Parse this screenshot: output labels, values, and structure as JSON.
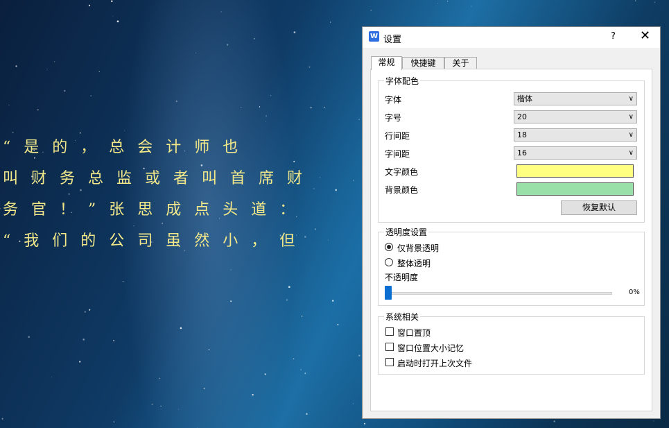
{
  "background_text": {
    "lines": [
      "    “是的，总会计师也",
      "叫财务总监或者叫首席财",
      "务官！”张思成点头道：",
      "“我们的公司虽然小，但"
    ],
    "color": "#f3e98a"
  },
  "dialog": {
    "title": "设置",
    "help_label": "?",
    "close_label": "✕",
    "app_icon": "wps-w-icon",
    "tabs": [
      {
        "label": "常规",
        "active": true
      },
      {
        "label": "快捷键",
        "active": false
      },
      {
        "label": "关于",
        "active": false
      }
    ],
    "font_group": {
      "title": "字体配色",
      "rows": [
        {
          "label": "字体",
          "value": "楷体"
        },
        {
          "label": "字号",
          "value": "20"
        },
        {
          "label": "行间距",
          "value": "18"
        },
        {
          "label": "字间距",
          "value": "16"
        }
      ],
      "text_color_label": "文字颜色",
      "text_color": "#ffff80",
      "bg_color_label": "背景颜色",
      "bg_color": "#99e0a8",
      "reset_label": "恢复默认"
    },
    "transparency_group": {
      "title": "透明度设置",
      "options": [
        {
          "label": "仅背景透明",
          "checked": true
        },
        {
          "label": "整体透明",
          "checked": false
        }
      ],
      "opacity_label": "不透明度",
      "opacity_value": "0%",
      "opacity_fraction": 0
    },
    "system_group": {
      "title": "系统相关",
      "options": [
        {
          "label": "窗口置顶",
          "checked": false
        },
        {
          "label": "窗口位置大小记忆",
          "checked": false
        },
        {
          "label": "启动时打开上次文件",
          "checked": false
        }
      ]
    }
  }
}
